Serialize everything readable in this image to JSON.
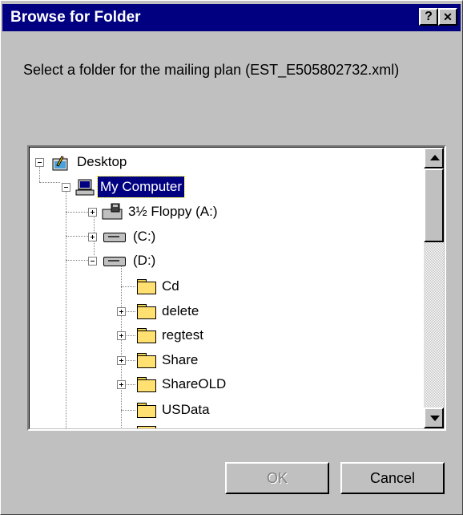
{
  "window": {
    "title": "Browse for Folder",
    "help_label": "?",
    "close_label": "✕"
  },
  "prompt": "Select a folder for the mailing plan (EST_E505802732.xml)",
  "tree": {
    "desktop": "Desktop",
    "my_computer": "My Computer",
    "floppy": "3½ Floppy (A:)",
    "drive_c": "(C:)",
    "drive_d": "(D:)",
    "folders": [
      "Cd",
      "delete",
      "regtest",
      "Share",
      "ShareOLD",
      "USData"
    ]
  },
  "buttons": {
    "ok": "OK",
    "cancel": "Cancel"
  },
  "icons": {
    "desktop": "desktop-icon",
    "computer": "computer-icon",
    "floppy": "floppy-drive-icon",
    "drive": "hard-drive-icon",
    "folder": "folder-icon"
  }
}
